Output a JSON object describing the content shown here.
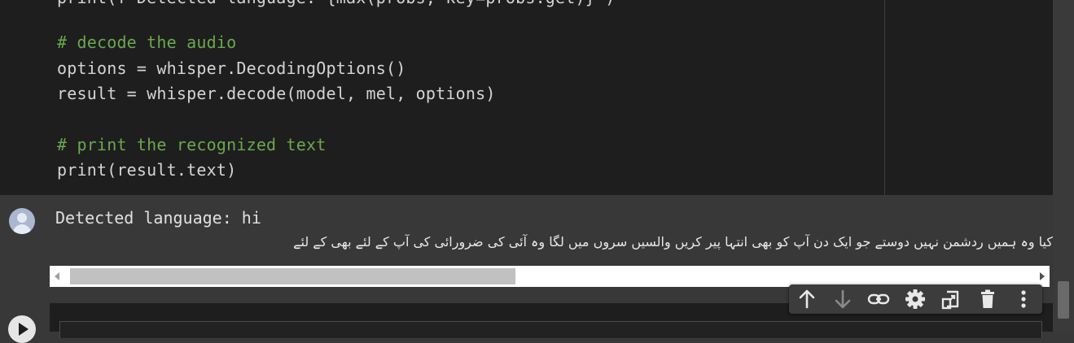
{
  "code": {
    "lines": [
      "print(f\"Detected language: {max(probs, key=probs.get)}\")",
      "# decode the audio",
      "options = whisper.DecodingOptions()",
      "result = whisper.decode(model, mel, options)",
      "# print the recognized text",
      "print(result.text)"
    ]
  },
  "output": {
    "detected": "Detected language: hi",
    "urdu_text": "کیا وہ ہمیں ردشمن نہیں دوستے جو ایک دن آپ کو بھی انتہا پیر کریں والسیں سروں میں لگا وہ آئی کی ضرورائی کی آپ کے لئے بھی کے لئے"
  },
  "toolbar": {
    "icons": [
      "arrow-up-icon",
      "arrow-down-icon",
      "link-icon",
      "gear-icon",
      "mirror-cell-icon",
      "trash-icon",
      "more-vert-icon"
    ]
  },
  "colors": {
    "code_bg": "#1e1e1e",
    "output_bg": "#383838",
    "comment": "#6aa84f",
    "code_text": "#d4d4d4"
  }
}
